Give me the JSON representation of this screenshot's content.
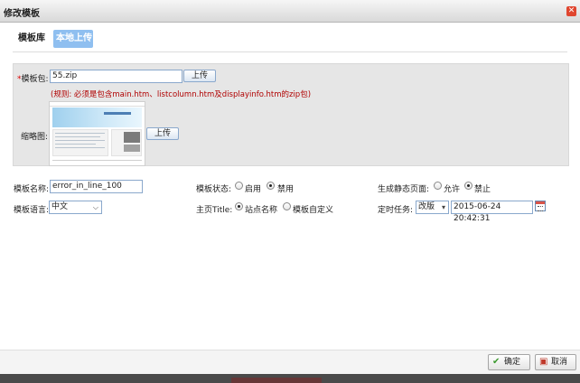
{
  "dialog": {
    "title": "修改模板",
    "close_icon": "close-icon"
  },
  "tabs": [
    {
      "label": "模板库"
    },
    {
      "label": "本地上传",
      "active": true
    }
  ],
  "upload": {
    "required_mark": "*",
    "package_label": "模板包:",
    "package_value": "55.zip",
    "upload_button": "上传",
    "rule_text": "(规则: 必须是包含main.htm、listcolumn.htm及displayinfo.htm的zip包)",
    "thumbnail_label": "缩略图:",
    "thumbnail_upload_button": "上传"
  },
  "form": {
    "template_name_label": "模板名称:",
    "template_name_value": "error_in_line_100",
    "template_status_label": "模板状态:",
    "status_options": [
      "启用",
      "禁用"
    ],
    "status_selected": "禁用",
    "static_page_label": "生成静态页面:",
    "static_options": [
      "允许",
      "禁止"
    ],
    "static_selected": "禁止",
    "language_label": "模板语言:",
    "language_value": "中文",
    "homepage_title_label": "主页Title:",
    "title_options": [
      "站点名称",
      "模板自定义"
    ],
    "title_selected": "站点名称",
    "scheduled_task_label": "定时任务:",
    "task_value": "改版",
    "task_datetime": "2015-06-24 20:42:31"
  },
  "footer": {
    "confirm": "确定",
    "cancel": "取消"
  },
  "colors": {
    "accent_tab": "#8fbff0",
    "rule_text": "#b00000",
    "close": "#e0462f"
  }
}
